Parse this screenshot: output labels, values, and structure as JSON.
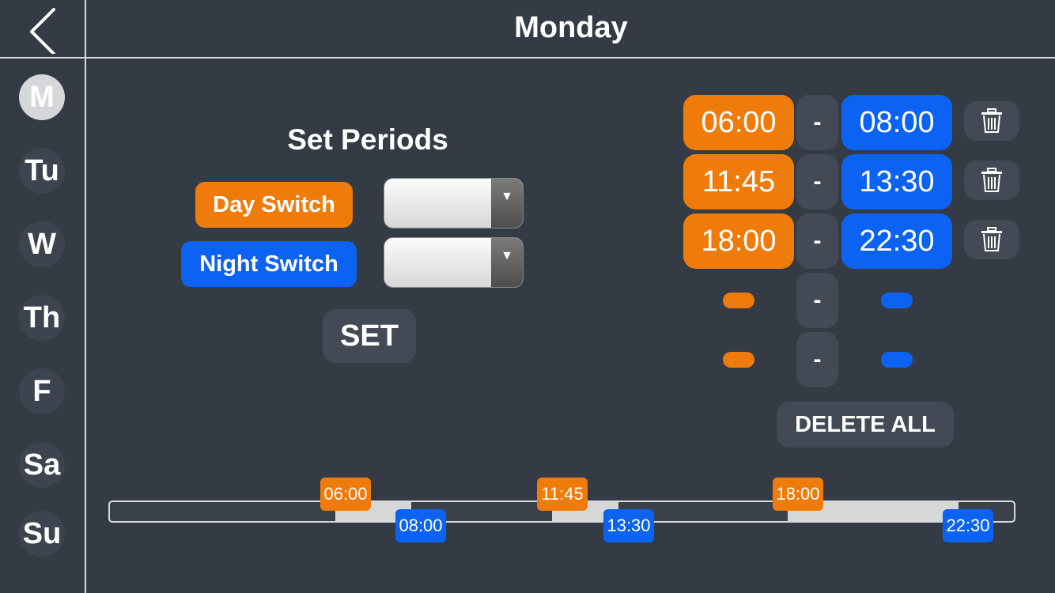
{
  "header": {
    "title": "Monday",
    "back_icon": "chevron-left-icon"
  },
  "days": [
    {
      "label": "M",
      "active": true
    },
    {
      "label": "Tu",
      "active": false
    },
    {
      "label": "W",
      "active": false
    },
    {
      "label": "Th",
      "active": false
    },
    {
      "label": "F",
      "active": false
    },
    {
      "label": "Sa",
      "active": false
    },
    {
      "label": "Su",
      "active": false
    }
  ],
  "setter": {
    "heading": "Set Periods",
    "day_switch_label": "Day Switch",
    "night_switch_label": "Night Switch",
    "day_select_value": "",
    "night_select_value": "",
    "set_label": "SET"
  },
  "periods": [
    {
      "start": "06:00",
      "separator": "-",
      "end": "08:00"
    },
    {
      "start": "11:45",
      "separator": "-",
      "end": "13:30"
    },
    {
      "start": "18:00",
      "separator": "-",
      "end": "22:30"
    },
    {
      "start": "",
      "separator": "-",
      "end": ""
    },
    {
      "start": "",
      "separator": "-",
      "end": ""
    }
  ],
  "delete_all_label": "DELETE ALL",
  "timeline": {
    "start_tags": [
      "06:00",
      "11:45",
      "18:00"
    ],
    "end_tags": [
      "08:00",
      "13:30",
      "22:30"
    ]
  },
  "colors": {
    "background": "#353b45",
    "day_accent": "#ef7b0b",
    "night_accent": "#0d63f1",
    "button_dark": "#434955"
  }
}
